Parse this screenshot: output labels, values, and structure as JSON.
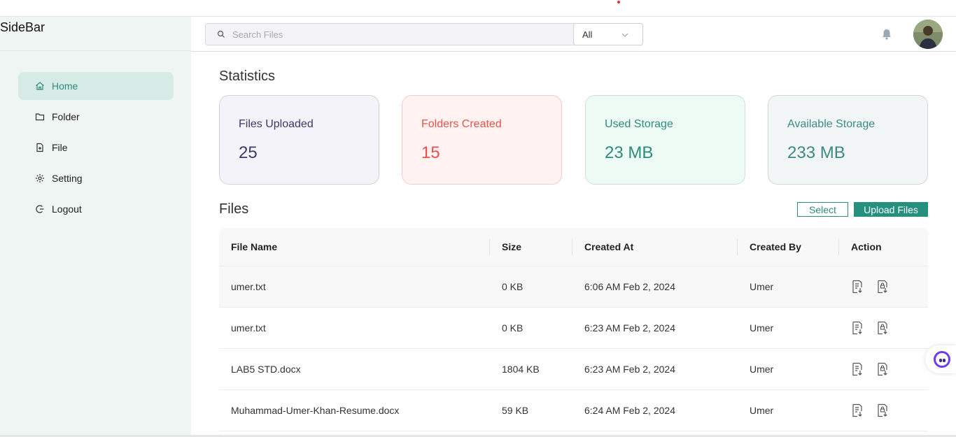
{
  "sidebar": {
    "title": "SideBar",
    "items": [
      {
        "label": "Home",
        "icon": "home-icon",
        "active": true
      },
      {
        "label": "Folder",
        "icon": "folder-icon"
      },
      {
        "label": "File",
        "icon": "file-icon"
      },
      {
        "label": "Setting",
        "icon": "gear-icon"
      },
      {
        "label": "Logout",
        "icon": "logout-icon"
      }
    ]
  },
  "header": {
    "search_placeholder": "Search Files",
    "filter_value": "All"
  },
  "statistics": {
    "title": "Statistics",
    "cards": [
      {
        "label": "Files Uploaded",
        "value": "25",
        "color": "#3c3a66"
      },
      {
        "label": "Folders Created",
        "value": "15",
        "color": "#e8514a"
      },
      {
        "label": "Used Storage",
        "value": "23 MB",
        "color": "#2e8c7c"
      },
      {
        "label": "Available Storage",
        "value": "233 MB",
        "color": "#3d8a86"
      }
    ]
  },
  "files": {
    "title": "Files",
    "select_label": "Select",
    "upload_label": "Upload Files",
    "columns": [
      "File Name",
      "Size",
      "Created At",
      "Created By",
      "Action"
    ],
    "rows": [
      {
        "name": "umer.txt",
        "size": "0 KB",
        "created_at": "6:06 AM Feb 2, 2024",
        "created_by": "Umer"
      },
      {
        "name": "umer.txt",
        "size": "0 KB",
        "created_at": "6:23 AM Feb 2, 2024",
        "created_by": "Umer"
      },
      {
        "name": "LAB5 STD.docx",
        "size": "1804 KB",
        "created_at": "6:23 AM Feb 2, 2024",
        "created_by": "Umer"
      },
      {
        "name": "Muhammad-Umer-Khan-Resume.docx",
        "size": "59 KB",
        "created_at": "6:24 AM Feb 2, 2024",
        "created_by": "Umer"
      }
    ]
  },
  "colors": {
    "accent": "#26907f",
    "sidebar_bg": "#eef5f3"
  }
}
